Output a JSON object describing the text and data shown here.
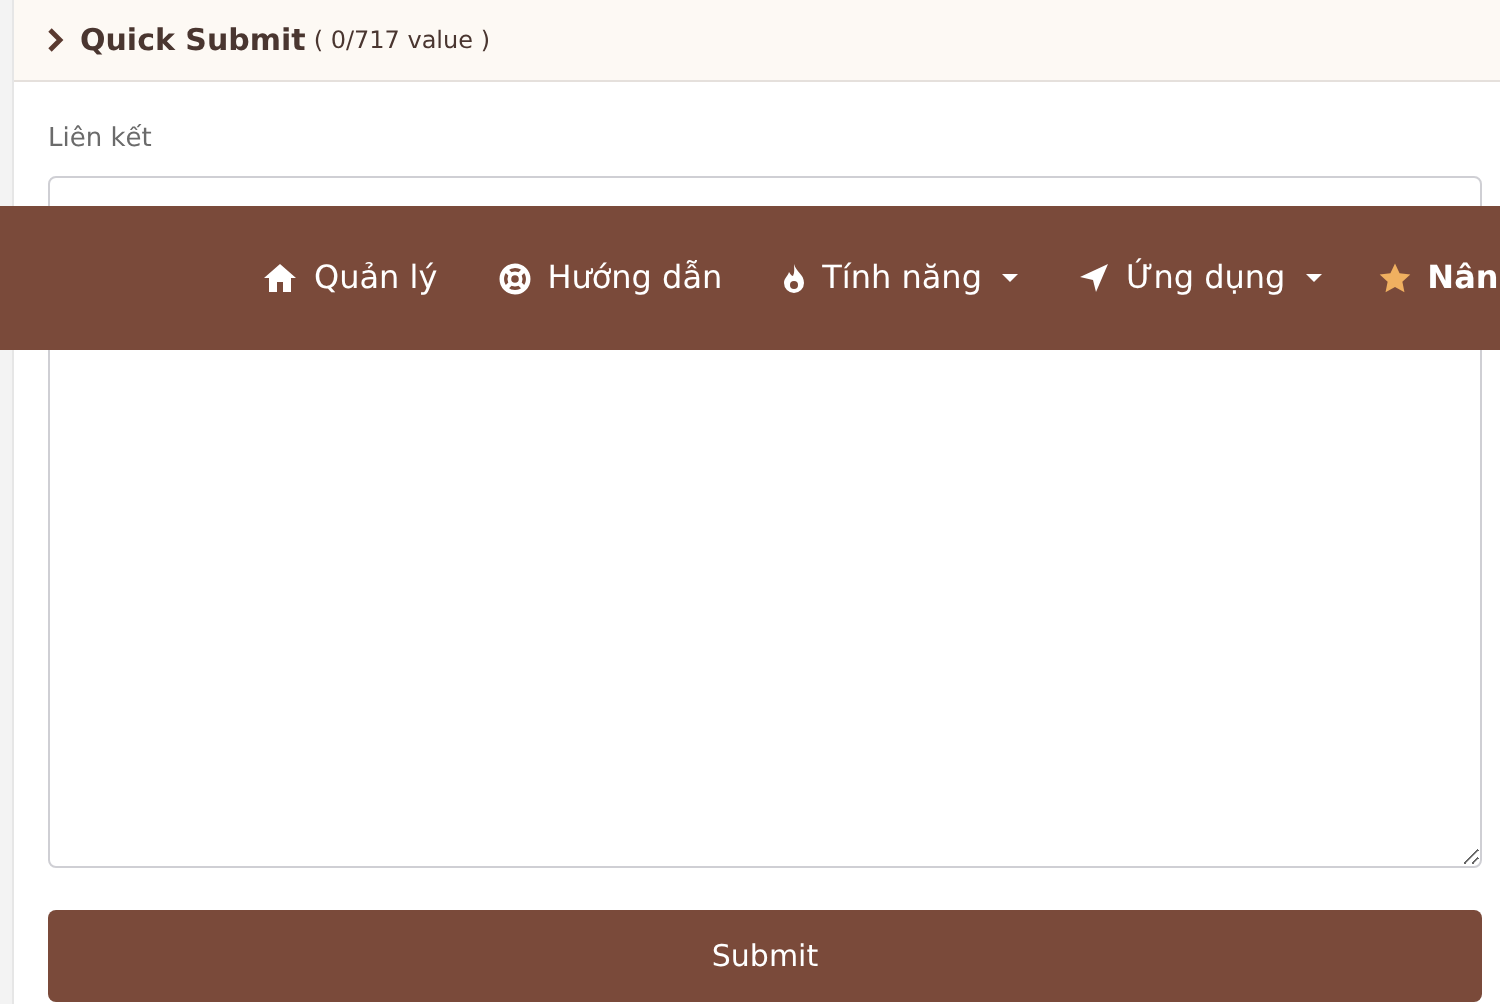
{
  "panel": {
    "title": "Quick Submit",
    "count": "( 0/717 value )",
    "expanded": false
  },
  "field": {
    "label": "Liên kết"
  },
  "submit": "Submit",
  "navbar": {
    "items": [
      {
        "label": "Quản lý",
        "kind": "home",
        "dropdown": false,
        "highlighted": false
      },
      {
        "label": "Hướng dẫn",
        "kind": "lifebuoy",
        "dropdown": false,
        "highlighted": false
      },
      {
        "label": "Tính năng",
        "kind": "fire",
        "dropdown": true,
        "highlighted": false
      },
      {
        "label": "Ứng dụng",
        "kind": "arrow",
        "dropdown": true,
        "highlighted": false
      },
      {
        "label": "Nân",
        "kind": "star",
        "dropdown": false,
        "highlighted": true
      }
    ]
  }
}
